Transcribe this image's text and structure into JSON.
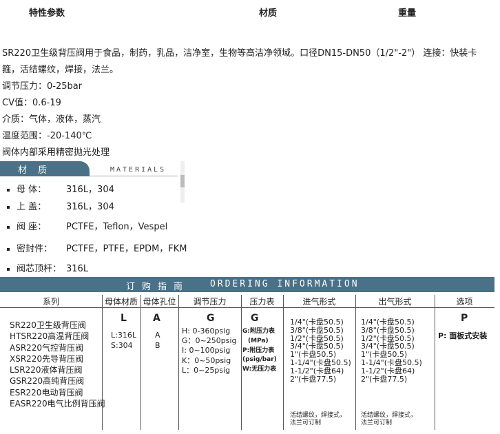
{
  "tabs": [
    "特性参数",
    "材质",
    "重量"
  ],
  "description": {
    "lines": [
      "SR220卫生级背压阀用于食品，制药，乳品，洁净室，生物等高洁净领域。口径DN15-DN50（1/2\"-2\"） 连接：快装卡",
      "箍，活结螺纹，焊接，法兰。",
      "调节压力：0-25bar",
      "CV值：0.6-19",
      "介质：气体，液体，蒸汽",
      "温度范围：-20-140℃",
      "阀体内部采用精密抛光处理"
    ]
  },
  "materials": {
    "title": "材 质",
    "title_en": "MATERIALS",
    "items": [
      {
        "label": "母 体：",
        "value": "316L，304"
      },
      {
        "label": "上 盖：",
        "value": "316L，304"
      },
      {
        "label": "阀 座：",
        "value": "PCTFE，Teflon，Vespel"
      },
      {
        "label": "密封件：",
        "value": "PCTFE，PTFE，EPDM，FKM"
      },
      {
        "label": "阀芯顶杆：",
        "value": "316L"
      }
    ]
  },
  "ordering": {
    "title_cn": "订购指南",
    "title_en": "ORDERING INFORMATION",
    "columns": [
      "系列",
      "母体材质",
      "母体孔位",
      "调节压力",
      "压力表",
      "进气形式",
      "出气形式",
      "选项"
    ],
    "series": [
      "SR220卫生级背压阀",
      "HTSR220高温背压阀",
      "ASR220气控背压阀",
      "XSR220先导背压阀",
      "LSR220液体背压阀",
      "GSR220高纯背压阀",
      "ESR220电动背压阀",
      "EASR220电气比例背压阀"
    ],
    "body_material": {
      "code": "L",
      "items": [
        "L:316L",
        "S:304"
      ]
    },
    "body_port": {
      "code": "A",
      "items": [
        "A",
        "B"
      ]
    },
    "pressure": {
      "code": "G",
      "items": [
        "H: 0-360psig",
        "G：0~250psig",
        "I: 0~100psig",
        "K：0~50psig",
        "L：0~25psig"
      ]
    },
    "gauge": {
      "code": "G",
      "items": [
        "G:附压力表",
        "(MPa)",
        "P:附压力表",
        "(psig/bar)",
        "W:无压力表"
      ]
    },
    "inlet": {
      "items": [
        "1/4\"(卡盘50.5)",
        "3/8\"(卡盘50.5)",
        "1/2\"(卡盘50.5)",
        "3/4\"(卡盘50.5)",
        "1\"(卡盘50.5)",
        "1-1/4\"(卡盘50.5)",
        "1-1/2\"(卡盘64)",
        "2\"(卡盘77.5)"
      ],
      "note": [
        "活结螺纹，焊接式，",
        "法兰可订制"
      ]
    },
    "outlet": {
      "items": [
        "1/4\"(卡盘50.5)",
        "3/8\"(卡盘50.5)",
        "1/2\"(卡盘50.5)",
        "3/4\"(卡盘50.5)",
        "1\"(卡盘50.5)",
        "1-1/4\"(卡盘50.5)",
        "1-1/2\"(卡盘64)",
        "2\"(卡盘77.5)"
      ],
      "note": [
        "活结螺纹，焊接式，",
        "法兰可订制"
      ]
    },
    "option": {
      "code": "P",
      "items": [
        "P: 面板式安装"
      ]
    }
  }
}
